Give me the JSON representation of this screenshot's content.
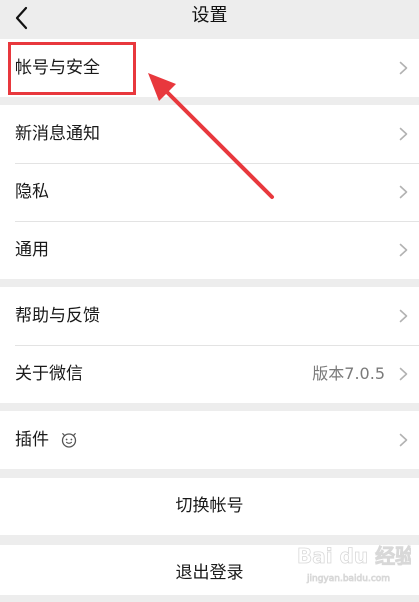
{
  "header": {
    "title": "设置",
    "back_icon": "chevron-left-icon"
  },
  "groups": [
    {
      "items": [
        {
          "label": "帐号与安全"
        }
      ]
    },
    {
      "items": [
        {
          "label": "新消息通知"
        },
        {
          "label": "隐私"
        },
        {
          "label": "通用"
        }
      ]
    },
    {
      "items": [
        {
          "label": "帮助与反馈"
        },
        {
          "label": "关于微信",
          "value": "版本7.0.5"
        }
      ]
    },
    {
      "items": [
        {
          "label": "插件",
          "icon": "plugin-face-icon"
        }
      ]
    }
  ],
  "actions": {
    "switch_account": "切换帐号",
    "logout": "退出登录"
  },
  "annotation": {
    "highlight_color": "#e8383d"
  },
  "watermark": {
    "text": "Bai du 经验",
    "subtext": "jingyan.baidu.com"
  }
}
